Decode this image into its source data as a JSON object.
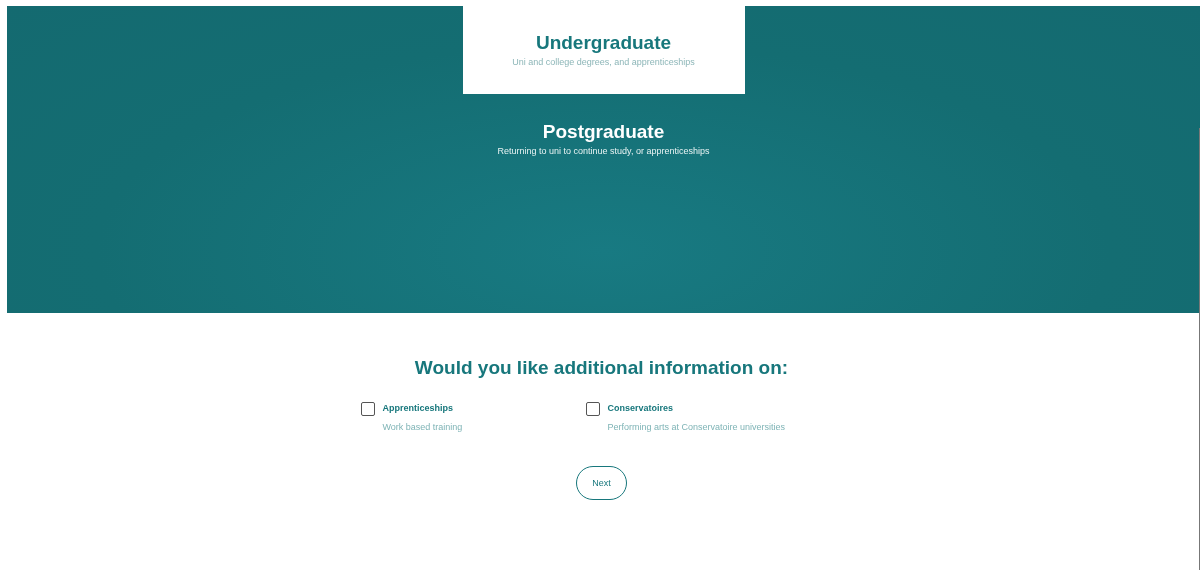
{
  "study_levels": [
    {
      "title": "Undergraduate",
      "subtitle": "Uni and college degrees, and apprenticeships",
      "selected": true
    },
    {
      "title": "Postgraduate",
      "subtitle": "Returning to uni to continue study, or apprenticeships",
      "selected": false
    }
  ],
  "additional_info": {
    "heading": "Would you like additional information on:",
    "options": [
      {
        "label": "Apprenticeships",
        "description": "Work based training",
        "checked": false
      },
      {
        "label": "Conservatoires",
        "description": "Performing arts at Conservatoire universities",
        "checked": false
      }
    ]
  },
  "buttons": [
    "Next"
  ]
}
